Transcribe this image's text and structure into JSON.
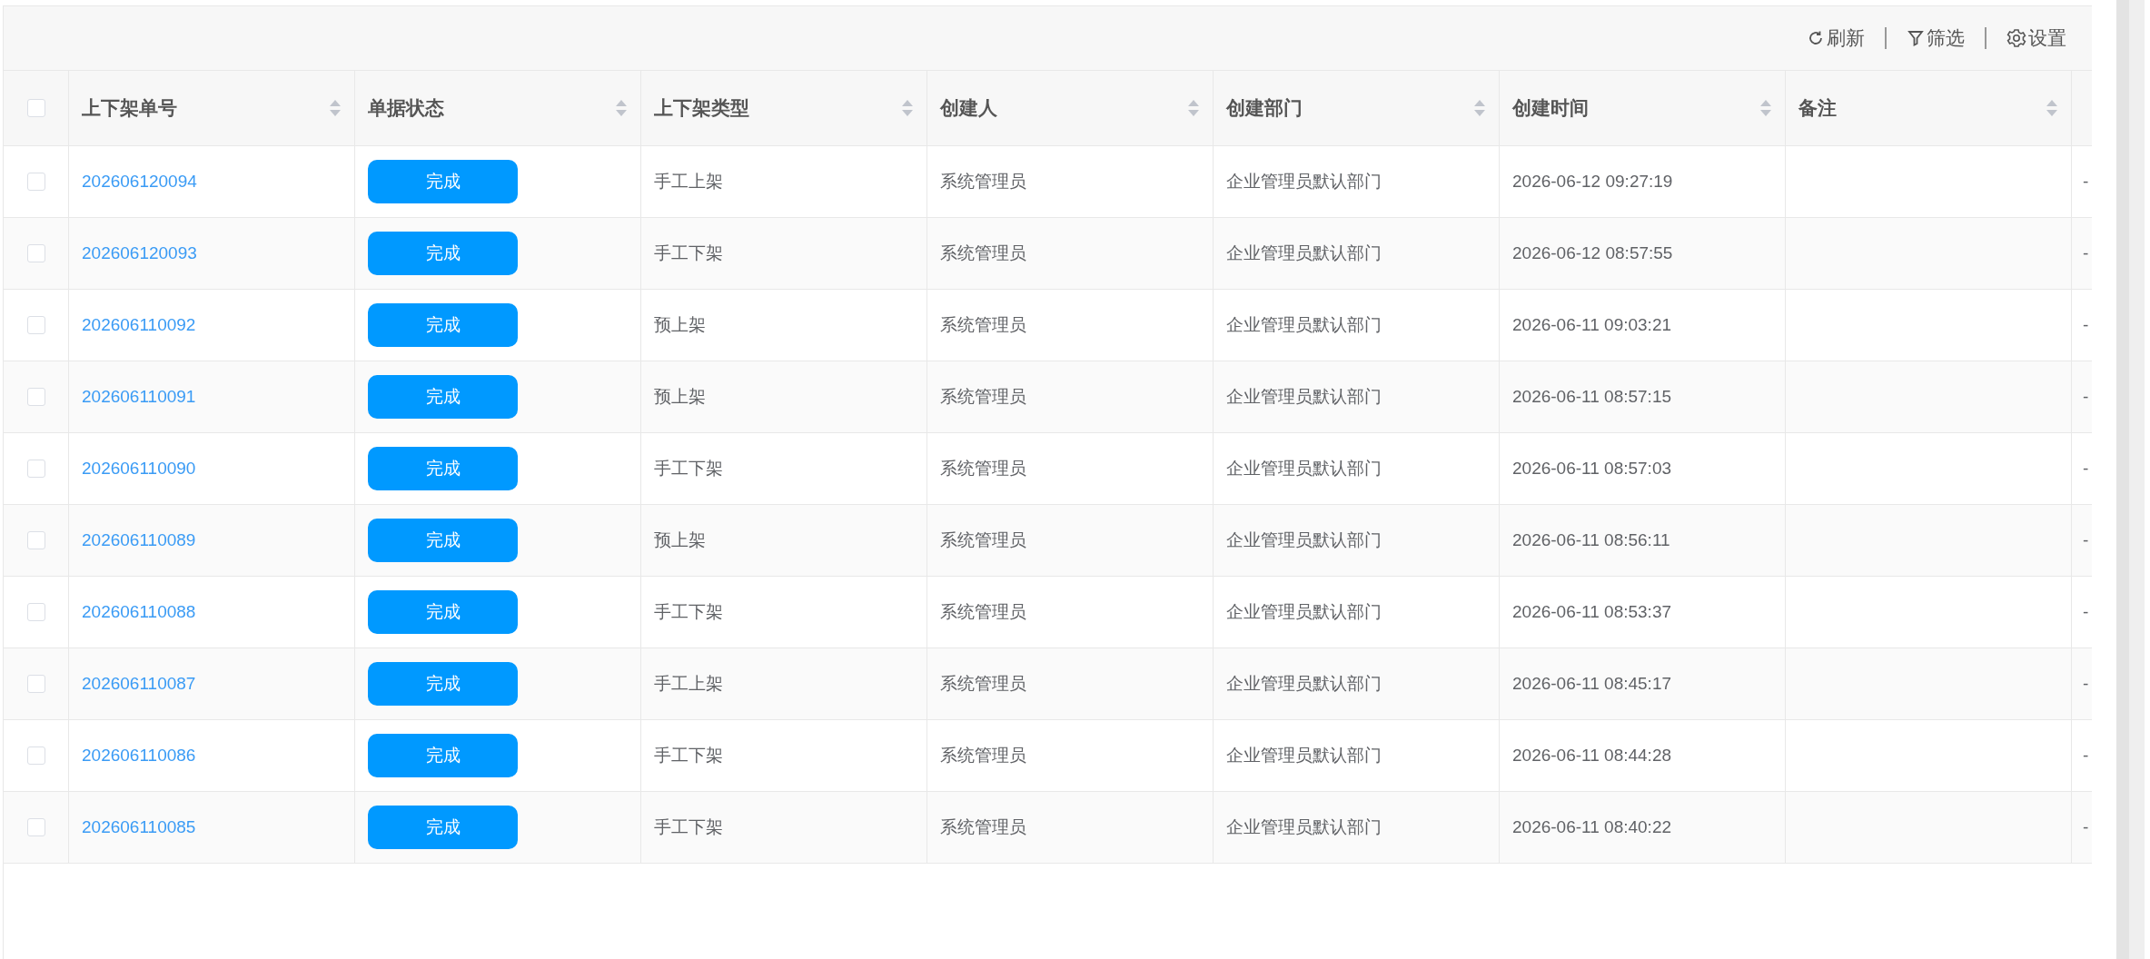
{
  "toolbar": {
    "actions": [
      {
        "kind": "refresh",
        "label": "刷新"
      },
      {
        "kind": "filter",
        "label": "筛选"
      },
      {
        "kind": "settings",
        "label": "设置"
      }
    ]
  },
  "table": {
    "select_all": {
      "checked": false
    },
    "columns": [
      {
        "label": "上下架单号"
      },
      {
        "label": "单据状态"
      },
      {
        "label": "上下架类型"
      },
      {
        "label": "创建人"
      },
      {
        "label": "创建部门"
      },
      {
        "label": "创建时间"
      },
      {
        "label": "备注"
      }
    ],
    "rows": [
      {
        "checked": false,
        "order_no": "202606120094",
        "status": "完成",
        "type": "手工上架",
        "creator": "系统管理员",
        "department": "企业管理员默认部门",
        "created_at": "2026-06-12 09:27:19",
        "column_8": "-"
      },
      {
        "checked": false,
        "order_no": "202606120093",
        "status": "完成",
        "type": "手工下架",
        "creator": "系统管理员",
        "department": "企业管理员默认部门",
        "created_at": "2026-06-12 08:57:55",
        "column_8": "-"
      },
      {
        "checked": false,
        "order_no": "202606110092",
        "status": "完成",
        "type": "预上架",
        "creator": "系统管理员",
        "department": "企业管理员默认部门",
        "created_at": "2026-06-11 09:03:21",
        "column_8": "-"
      },
      {
        "checked": false,
        "order_no": "202606110091",
        "status": "完成",
        "type": "预上架",
        "creator": "系统管理员",
        "department": "企业管理员默认部门",
        "created_at": "2026-06-11 08:57:15",
        "column_8": "-"
      },
      {
        "checked": false,
        "order_no": "202606110090",
        "status": "完成",
        "type": "手工下架",
        "creator": "系统管理员",
        "department": "企业管理员默认部门",
        "created_at": "2026-06-11 08:57:03",
        "column_8": "-"
      },
      {
        "checked": false,
        "order_no": "202606110089",
        "status": "完成",
        "type": "预上架",
        "creator": "系统管理员",
        "department": "企业管理员默认部门",
        "created_at": "2026-06-11 08:56:11",
        "column_8": "-"
      },
      {
        "checked": false,
        "order_no": "202606110088",
        "status": "完成",
        "type": "手工下架",
        "creator": "系统管理员",
        "department": "企业管理员默认部门",
        "created_at": "2026-06-11 08:53:37",
        "column_8": "-"
      },
      {
        "checked": false,
        "order_no": "202606110087",
        "status": "完成",
        "type": "手工上架",
        "creator": "系统管理员",
        "department": "企业管理员默认部门",
        "created_at": "2026-06-11 08:45:17",
        "column_8": "-"
      },
      {
        "checked": false,
        "order_no": "202606110086",
        "status": "完成",
        "type": "手工下架",
        "creator": "系统管理员",
        "department": "企业管理员默认部门",
        "created_at": "2026-06-11 08:44:28",
        "column_8": "-"
      },
      {
        "checked": false,
        "order_no": "202606110085",
        "status": "完成",
        "type": "手工下架",
        "creator": "系统管理员",
        "department": "企业管理员默认部门",
        "created_at": "2026-06-11 08:40:22",
        "column_8": "-"
      }
    ]
  }
}
